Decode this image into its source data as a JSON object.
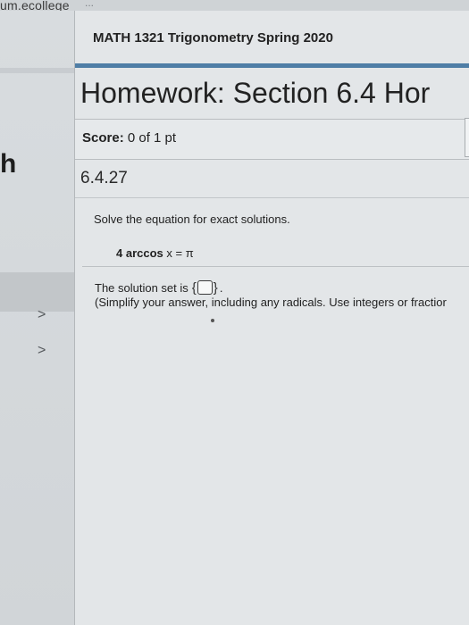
{
  "browser": {
    "url_visible": "um.ecollege",
    "url_faded": "..."
  },
  "sidebar": {
    "heading_fragment": "h",
    "chevrons": [
      ">",
      ">"
    ]
  },
  "course": {
    "title": "MATH 1321 Trigonometry Spring 2020"
  },
  "homework": {
    "title": "Homework: Section 6.4 Hor"
  },
  "score": {
    "label": "Score:",
    "value": "0 of 1 pt"
  },
  "question": {
    "number": "6.4.27",
    "instruction": "Solve the equation for exact solutions.",
    "equation_bold": "4 arccos",
    "equation_rest": "x = π",
    "answer_prefix": "The solution set is",
    "brace_open": "{",
    "brace_close": "}",
    "answer_period": ".",
    "answer_value": "",
    "hint": "(Simplify your answer, including any radicals. Use integers or fractior"
  }
}
